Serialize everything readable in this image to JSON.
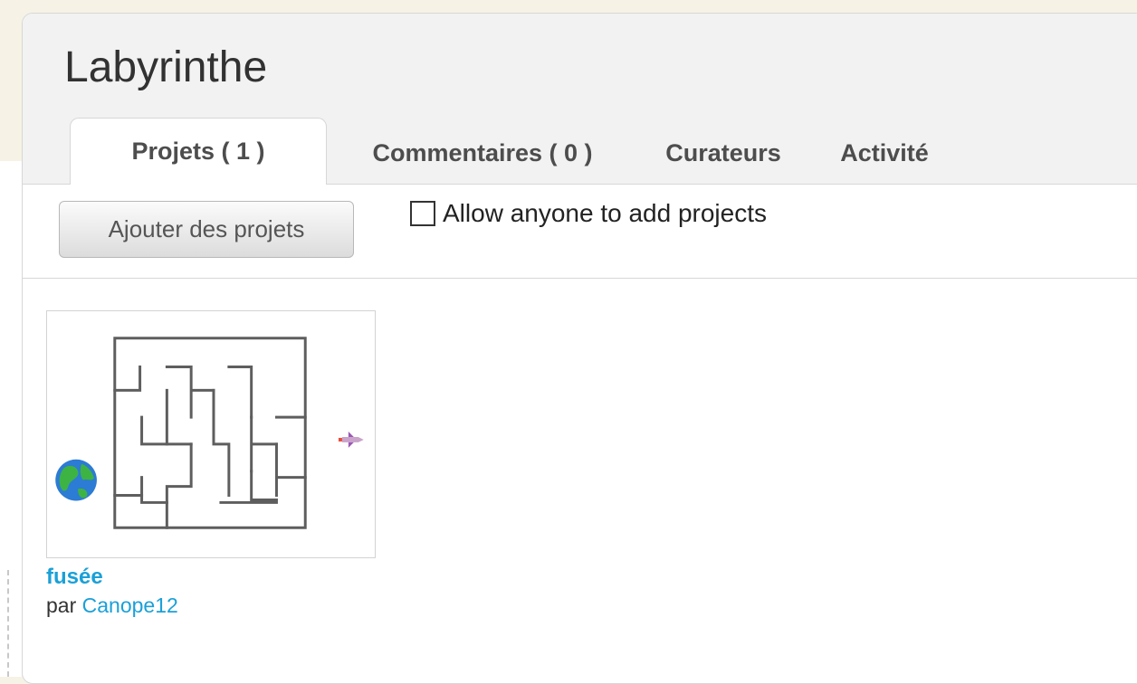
{
  "gallery": {
    "title": "Labyrinthe"
  },
  "tabs": [
    {
      "label": "Projets ( 1 )",
      "active": true
    },
    {
      "label": "Commentaires ( 0 )",
      "active": false
    },
    {
      "label": "Curateurs",
      "active": false
    },
    {
      "label": "Activité",
      "active": false
    }
  ],
  "toolbar": {
    "add_projects_label": "Ajouter des projets",
    "allow_anyone_label": "Allow anyone to add projects",
    "allow_anyone_checked": false
  },
  "projects": [
    {
      "title": "fusée",
      "by_prefix": "par",
      "author": "Canope12",
      "thumbnail_icons": [
        "maze-icon",
        "globe-icon",
        "rocket-icon"
      ]
    }
  ],
  "colors": {
    "link": "#1aa0d8",
    "tab_text": "#4d4d4d",
    "header_bg": "#f2f2f2",
    "page_bg": "#f6f3e6"
  }
}
